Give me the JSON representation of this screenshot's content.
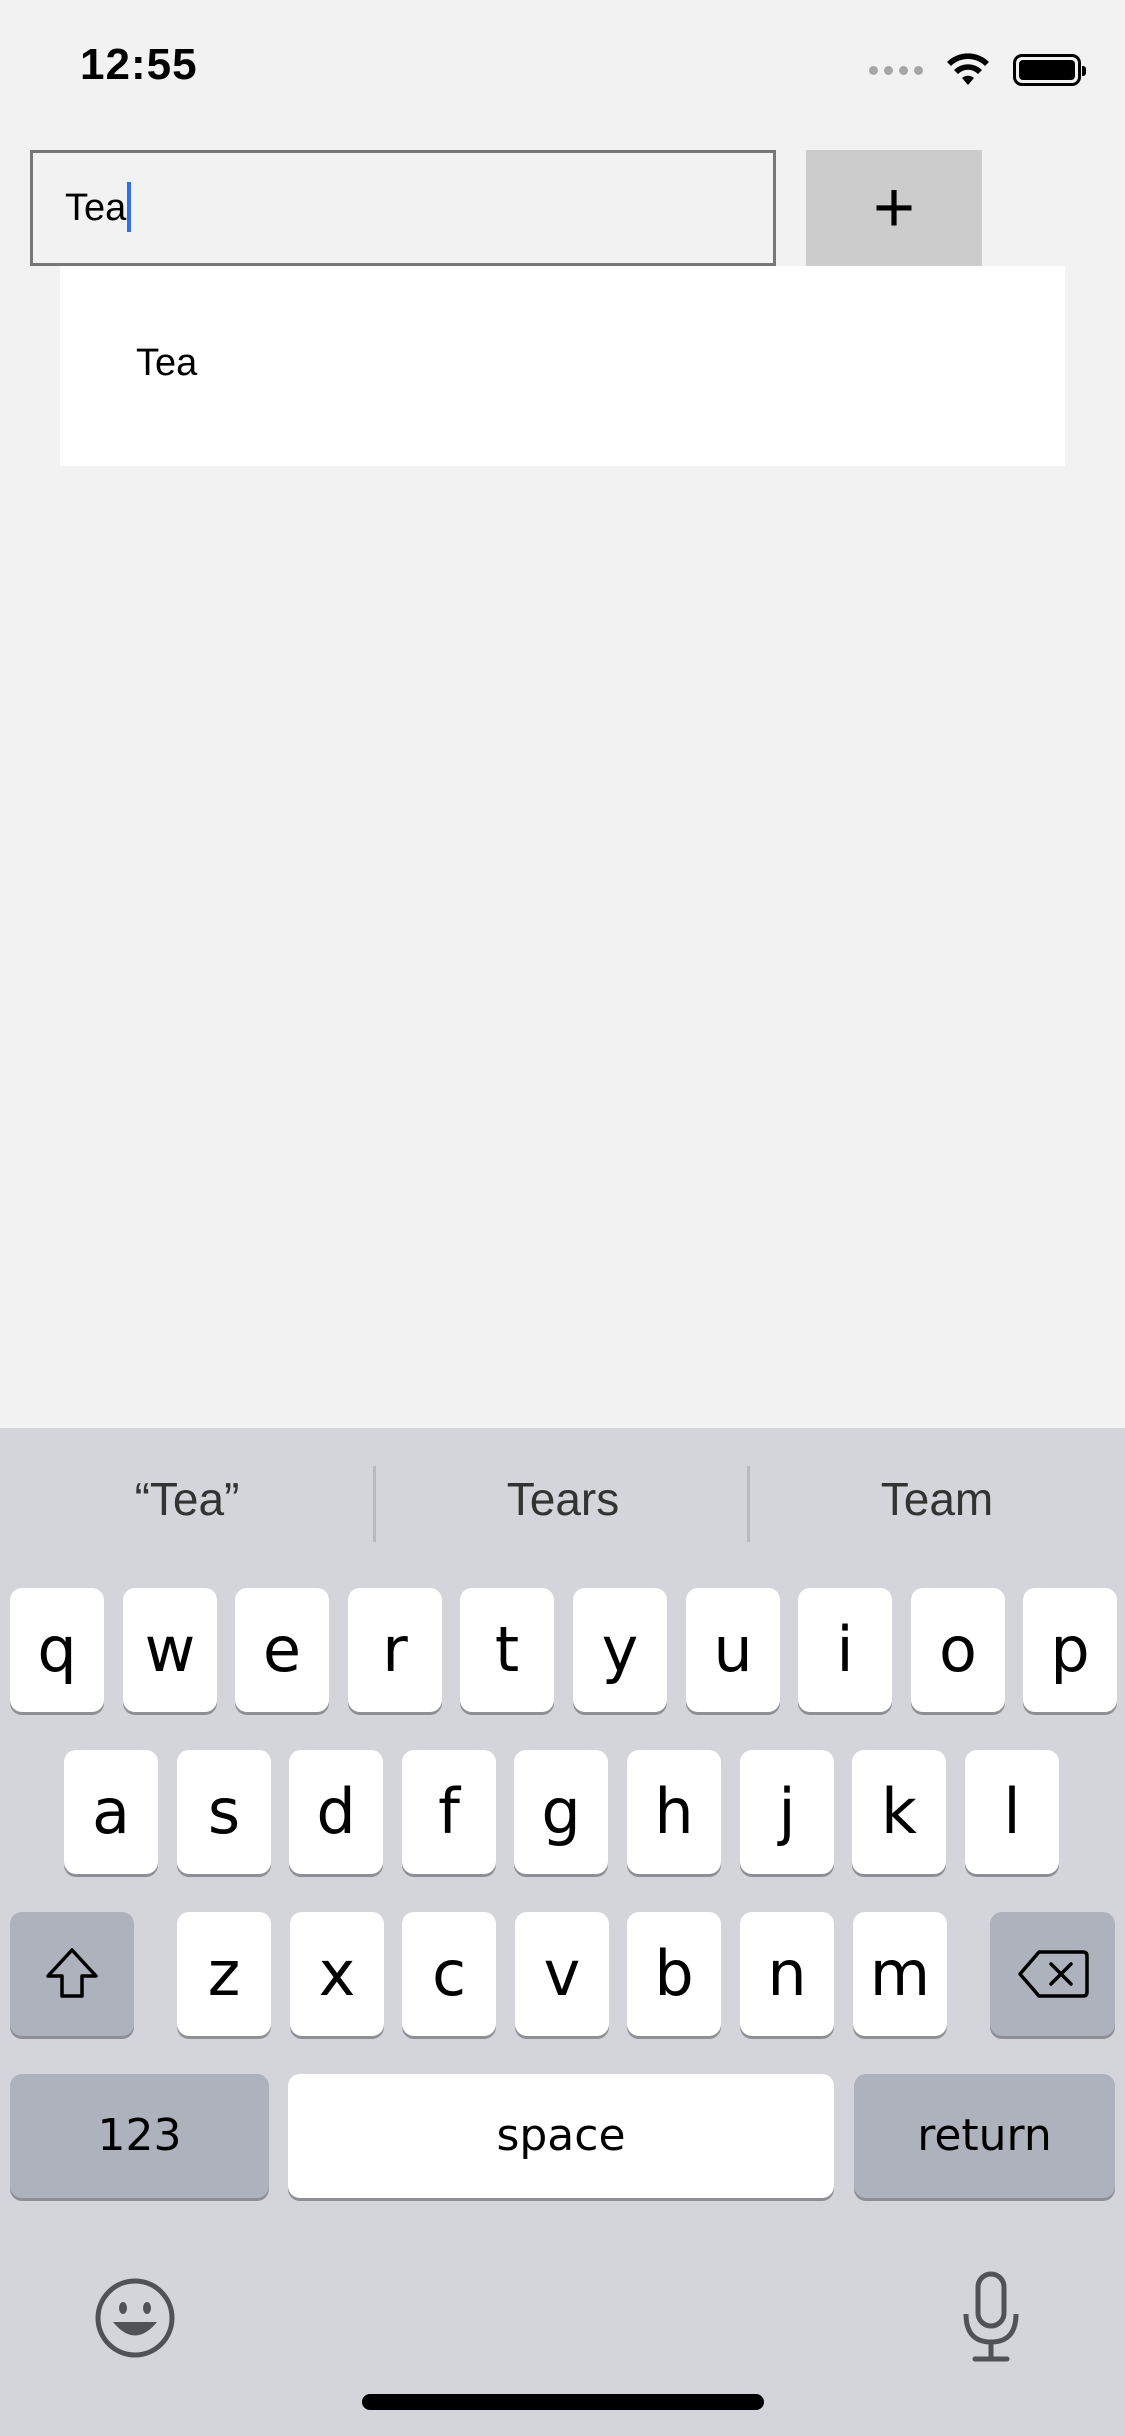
{
  "status_bar": {
    "time": "12:55",
    "icons": [
      "signal-icon",
      "wifi-icon",
      "battery-icon"
    ]
  },
  "input": {
    "value": "Tea",
    "placeholder": ""
  },
  "add_button": {
    "label": "+"
  },
  "suggestions": [
    {
      "label": "Tea"
    }
  ],
  "keyboard": {
    "predictions": [
      "“Tea”",
      "Tears",
      "Team"
    ],
    "row1": [
      "q",
      "w",
      "e",
      "r",
      "t",
      "y",
      "u",
      "i",
      "o",
      "p"
    ],
    "row2": [
      "a",
      "s",
      "d",
      "f",
      "g",
      "h",
      "j",
      "k",
      "l"
    ],
    "row3": [
      "z",
      "x",
      "c",
      "v",
      "b",
      "n",
      "m"
    ],
    "numbers_label": "123",
    "space_label": "space",
    "return_label": "return",
    "icons": [
      "shift-icon",
      "backspace-icon",
      "emoji-icon",
      "microphone-icon"
    ]
  },
  "colors": {
    "background": "#f2f2f2",
    "keyboard": "#d4d5da",
    "caret": "#2f6fed",
    "add_button": "#cccccc"
  }
}
